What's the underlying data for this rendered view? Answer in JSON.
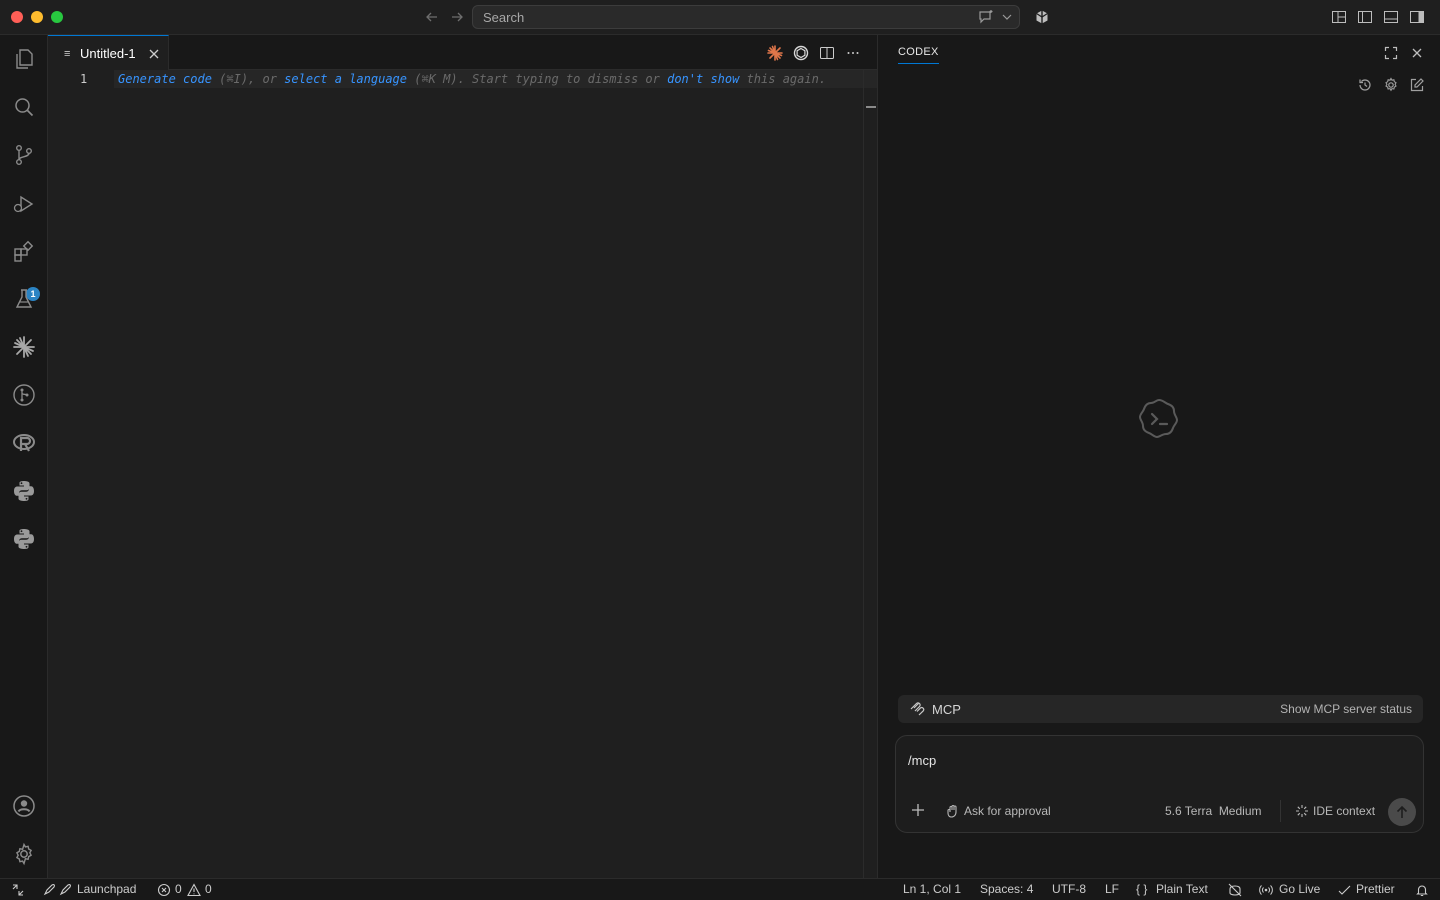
{
  "titlebar": {
    "search_placeholder": "Search"
  },
  "activity_bar": {
    "items": [
      "explorer",
      "search",
      "source-control",
      "run-debug",
      "extensions",
      "testing",
      "claude",
      "gitlens",
      "r",
      "python",
      "python-env"
    ],
    "extensions_badge": "1"
  },
  "editor": {
    "tab_label": "Untitled-1",
    "line_number": "1",
    "hint": {
      "generate": "Generate code",
      "generate_shortcut": " (⌘I), or ",
      "select": "select a language",
      "select_shortcut": " (⌘K M). Start typing to dismiss or ",
      "dont_show": "don't show",
      "tail": " this again."
    }
  },
  "panel": {
    "title": "CODEX",
    "mcp_label": "MCP",
    "mcp_description": "Show MCP server status",
    "composer_text": "/mcp",
    "approval_label": "Ask for approval",
    "model_label": "5.6 Terra",
    "effort_label": "Medium",
    "context_label": "IDE context"
  },
  "status_bar": {
    "launchpad": "Launchpad",
    "errors": "0",
    "warnings": "0",
    "position": "Ln 1, Col 1",
    "spaces": "Spaces: 4",
    "encoding": "UTF-8",
    "eol": "LF",
    "braces": "{ }",
    "language": "Plain Text",
    "golive": "Go Live",
    "prettier": "Prettier"
  },
  "colors": {
    "accent": "#0078d4",
    "link": "#3794ff",
    "badge": "#2b84c4",
    "claude": "#e0764a"
  }
}
